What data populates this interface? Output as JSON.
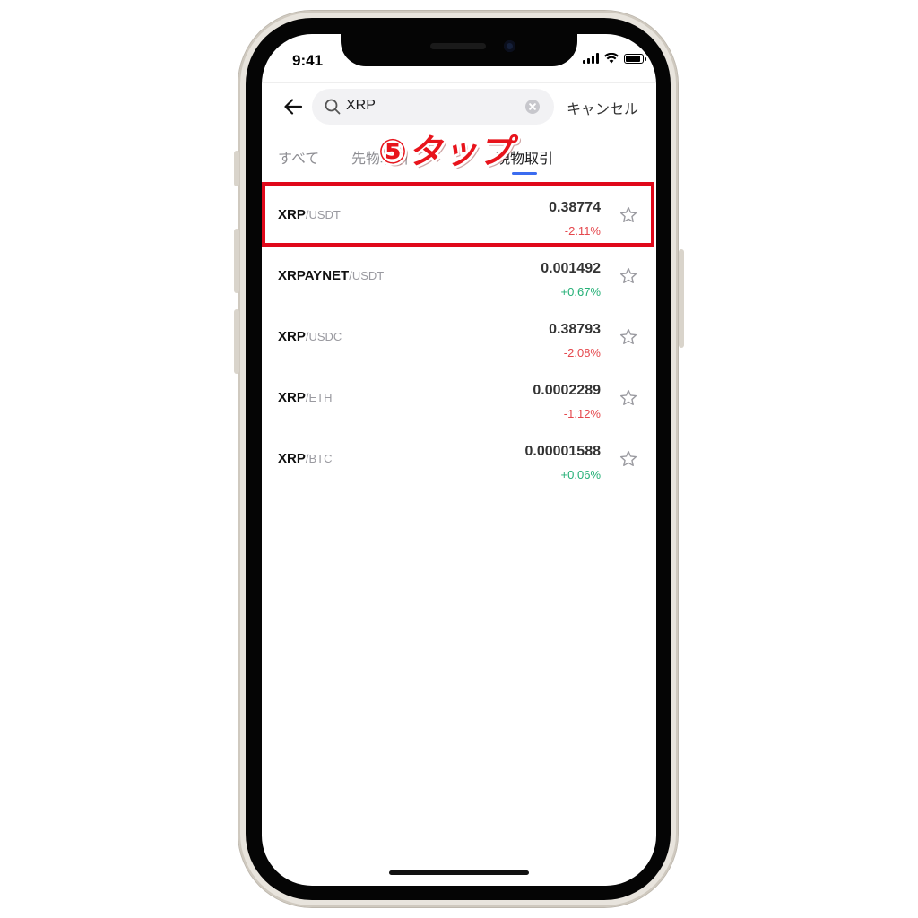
{
  "status_bar": {
    "time": "9:41"
  },
  "search": {
    "value": "XRP"
  },
  "header": {
    "cancel_label": "キャンセル"
  },
  "tabs": [
    {
      "label": "すべて",
      "active": false
    },
    {
      "label": "先物取引",
      "active": false
    },
    {
      "label": "現物取引",
      "active": true
    }
  ],
  "annotation": {
    "text": "⑤タップ"
  },
  "pairs": [
    {
      "base": "XRP",
      "quote": "/USDT",
      "price": "0.38774",
      "change": "-2.11%",
      "direction": "neg"
    },
    {
      "base": "XRPAYNET",
      "quote": "/USDT",
      "price": "0.001492",
      "change": "+0.67%",
      "direction": "pos"
    },
    {
      "base": "XRP",
      "quote": "/USDC",
      "price": "0.38793",
      "change": "-2.08%",
      "direction": "neg"
    },
    {
      "base": "XRP",
      "quote": "/ETH",
      "price": "0.0002289",
      "change": "-1.12%",
      "direction": "neg"
    },
    {
      "base": "XRP",
      "quote": "/BTC",
      "price": "0.00001588",
      "change": "+0.06%",
      "direction": "pos"
    }
  ],
  "colors": {
    "negative": "#e5484d",
    "positive": "#25b077",
    "tab_indicator": "#3b6cf0",
    "highlight": "#e0081a"
  },
  "icons": {
    "back": "arrow-left-icon",
    "search": "search-icon",
    "clear": "clear-icon",
    "favorite": "star-outline-icon"
  }
}
